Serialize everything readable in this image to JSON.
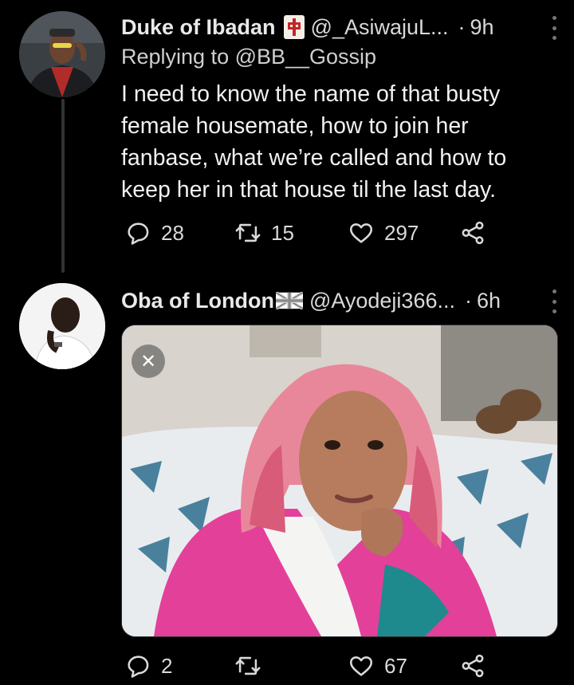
{
  "tweets": [
    {
      "name": "Duke of Ibadan",
      "handle": "@_AsiwajuL...",
      "dot": "·",
      "time": "9h",
      "reply_to": "Replying to @BB__Gossip",
      "text": "I need to know the name of that busty female housemate, how to join her fanbase, what we’re called and how to keep her in that house til the last day.",
      "replies": "28",
      "retweets": "15",
      "likes": "297"
    },
    {
      "name": "Oba of London",
      "handle": "@Ayodeji366...",
      "dot": "·",
      "time": "6h",
      "replies": "2",
      "retweets": "",
      "likes": "67",
      "media_close": "✕"
    }
  ],
  "icons": {
    "reply": "speech-bubble-icon",
    "retweet": "retweet-icon",
    "like": "heart-icon",
    "share": "share-icon",
    "more": "more-vertical-icon"
  },
  "colors": {
    "background": "#000000",
    "text": "#e7e9ea",
    "secondary": "#d9d9d9"
  }
}
